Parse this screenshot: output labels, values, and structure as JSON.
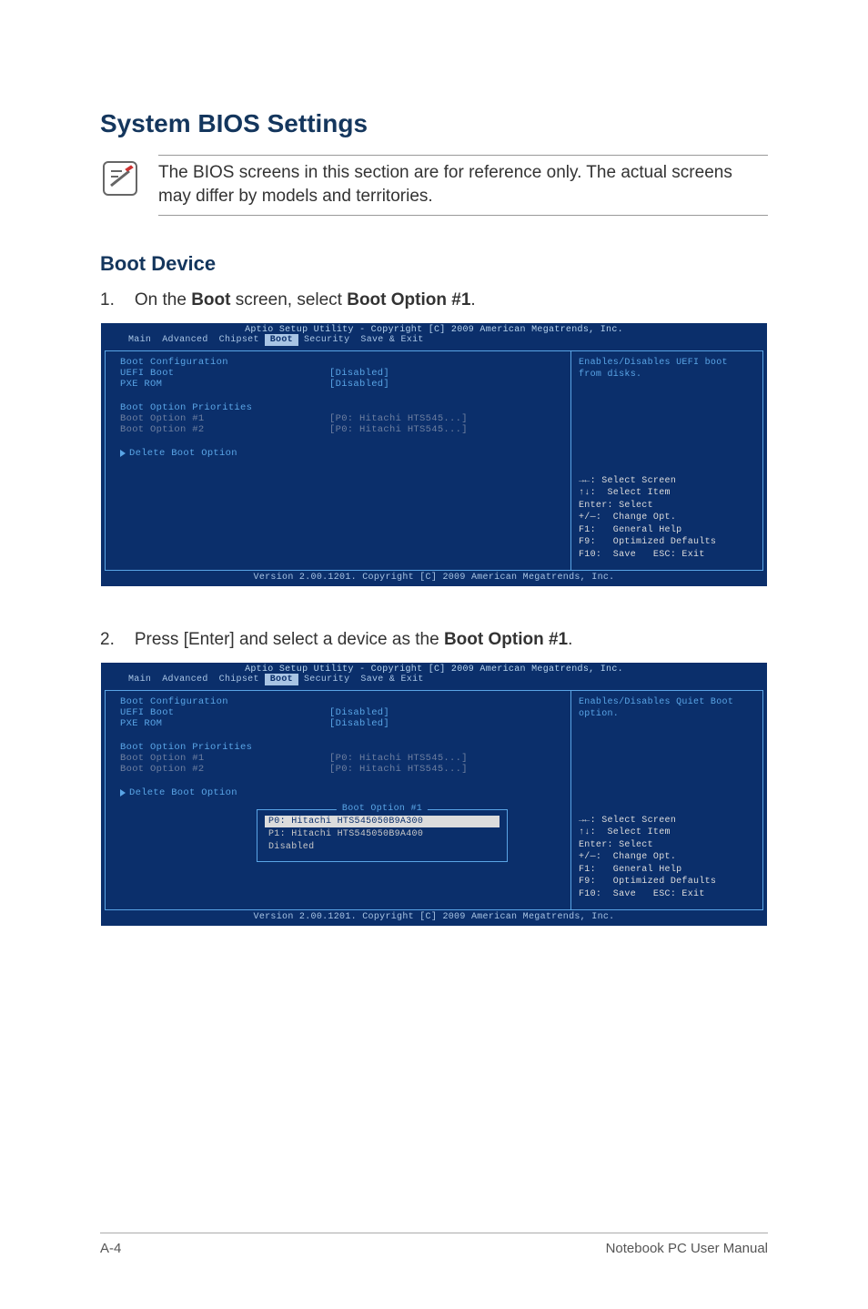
{
  "page": {
    "heading": "System BIOS Settings",
    "note": "The BIOS screens in this section are for reference only. The actual screens may differ by models and territories.",
    "subHeading": "Boot Device",
    "step1_num": "1.",
    "step1_pre": "On the ",
    "step1_bold1": "Boot",
    "step1_mid": " screen, select ",
    "step1_bold2": "Boot Option #1",
    "step1_post": ".",
    "step2_num": "2.",
    "step2_pre": "Press [Enter] and select a device as the ",
    "step2_bold": "Boot Option #1",
    "step2_post": ".",
    "footer_left": "A-4",
    "footer_right": "Notebook PC User Manual"
  },
  "bios": {
    "title": "Aptio Setup Utility - Copyright [C] 2009 American Megatrends, Inc.",
    "tabs": [
      "Main",
      "Advanced",
      "Chipset",
      "Boot",
      "Security",
      "Save & Exit"
    ],
    "footer": "Version 2.00.1201. Copyright [C] 2009 American Megatrends, Inc.",
    "cfgHeading": "Boot Configuration",
    "uefiLabel": "UEFI Boot",
    "uefiVal": "[Disabled]",
    "pxeLabel": "PXE ROM",
    "pxeVal": "[Disabled]",
    "prioHeading": "Boot Option Priorities",
    "opt1Label": "Boot Option #1",
    "opt1Val": "[P0: Hitachi HTS545...]",
    "opt2Label": "Boot Option #2",
    "opt2Val": "[P0: Hitachi HTS545...]",
    "deleteOpt": "Delete Boot Option",
    "help1": "Enables/Disables UEFI boot from disks.",
    "help2": "Enables/Disables Quiet Boot option.",
    "helpKeys": "→←: Select Screen\n↑↓:  Select Item\nEnter: Select\n+/—:  Change Opt.\nF1:   General Help\nF9:   Optimized Defaults\nF10:  Save   ESC: Exit"
  },
  "popup": {
    "title": "Boot Option #1",
    "items": [
      "P0: Hitachi HTS545050B9A300",
      "P1: Hitachi HTS545050B9A400",
      "Disabled"
    ]
  }
}
